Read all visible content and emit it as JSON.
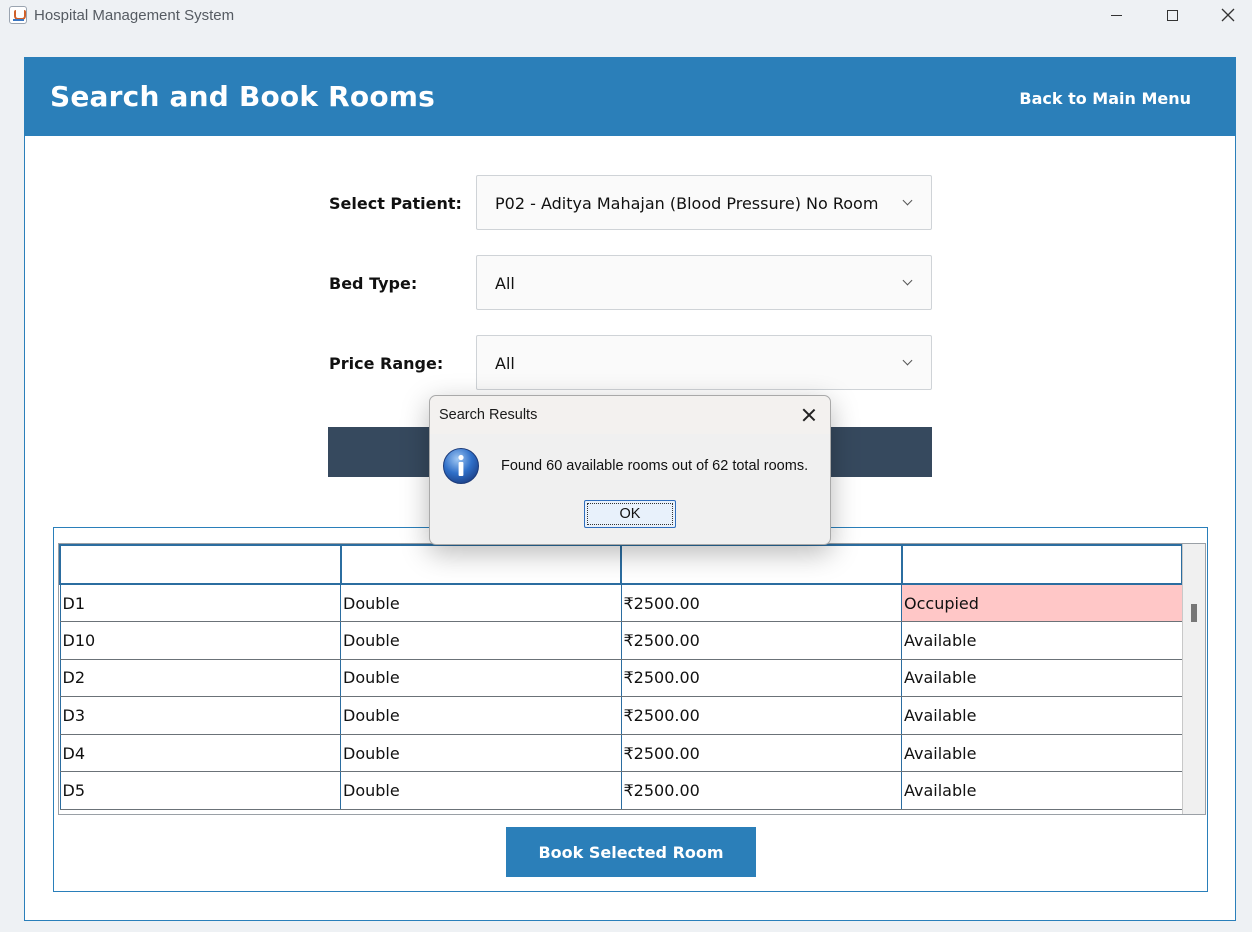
{
  "window": {
    "title": "Hospital Management System"
  },
  "header": {
    "title": "Search and Book Rooms",
    "back_label": "Back to Main Menu"
  },
  "form": {
    "patient": {
      "label": "Select Patient:",
      "value": "P02 - Aditya Mahajan  (Blood Pressure) No Room"
    },
    "bed_type": {
      "label": "Bed Type:",
      "value": "All"
    },
    "price_range": {
      "label": "Price Range:",
      "value": "All"
    }
  },
  "table": {
    "rows": [
      {
        "room": "D1",
        "type": "Double",
        "price": "₹2500.00",
        "status": "Occupied"
      },
      {
        "room": "D10",
        "type": "Double",
        "price": "₹2500.00",
        "status": "Available"
      },
      {
        "room": "D2",
        "type": "Double",
        "price": "₹2500.00",
        "status": "Available"
      },
      {
        "room": "D3",
        "type": "Double",
        "price": "₹2500.00",
        "status": "Available"
      },
      {
        "room": "D4",
        "type": "Double",
        "price": "₹2500.00",
        "status": "Available"
      },
      {
        "room": "D5",
        "type": "Double",
        "price": "₹2500.00",
        "status": "Available"
      }
    ],
    "occupied_color": "#ffc7c7"
  },
  "book_button": {
    "label": "Book Selected Room"
  },
  "dialog": {
    "title": "Search Results",
    "message": "Found 60 available rooms out of 62 total rooms.",
    "ok_label": "OK",
    "icon": "info-icon"
  },
  "colors": {
    "header": "#2b7fb9",
    "search_button": "#36495e"
  }
}
